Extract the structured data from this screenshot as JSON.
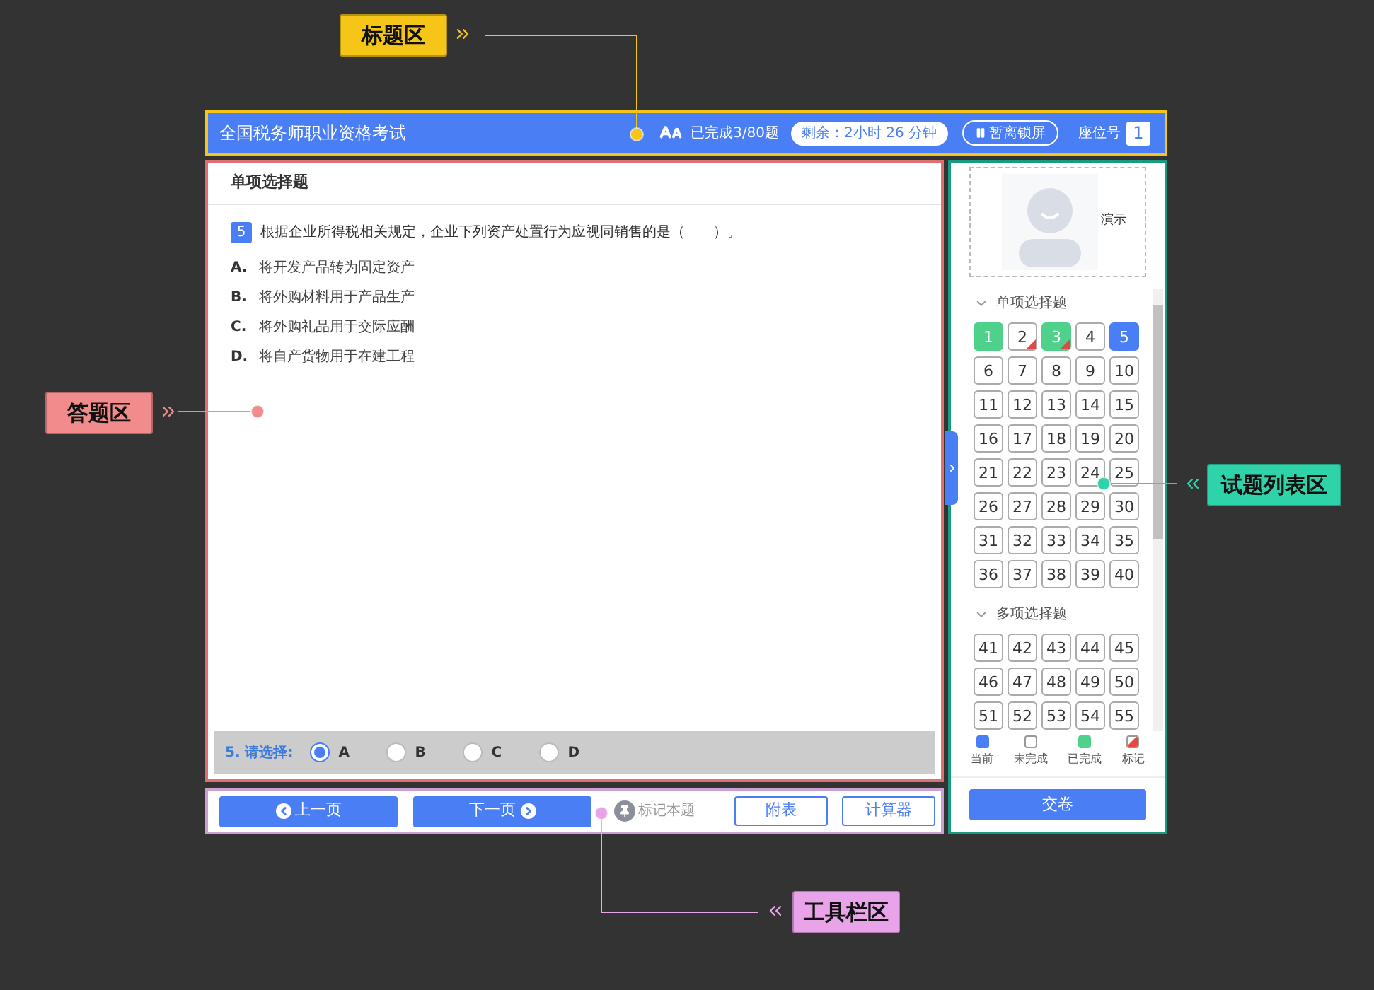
{
  "annotations": [
    {
      "label": "标题区",
      "color": "#f5c518"
    },
    {
      "label": "答题区",
      "color": "#f28b8b"
    },
    {
      "label": "试题列表区",
      "color": "#2fd3a9"
    },
    {
      "label": "工具栏区",
      "color": "#e9a3e9"
    }
  ],
  "header": {
    "title": "全国税务师职业资格考试",
    "progress": "已完成3/80题",
    "timer": "剩余：2小时 26 分钟",
    "lock_button": "暂离锁屏",
    "seat_label": "座位号",
    "seat_number": "1"
  },
  "question": {
    "section": "单项选择题",
    "number": "5",
    "text": "根据企业所得税相关规定，企业下列资产处置行为应视同销售的是（　　）。",
    "options": [
      {
        "letter": "A.",
        "text": "将开发产品转为固定资产"
      },
      {
        "letter": "B.",
        "text": "将外购材料用于产品生产"
      },
      {
        "letter": "C.",
        "text": "将外购礼品用于交际应酬"
      },
      {
        "letter": "D.",
        "text": "将自产货物用于在建工程"
      }
    ]
  },
  "answer_bar": {
    "prompt": "5. 请选择:",
    "choices": [
      {
        "label": "A",
        "selected": true
      },
      {
        "label": "B",
        "selected": false
      },
      {
        "label": "C",
        "selected": false
      },
      {
        "label": "D",
        "selected": false
      }
    ]
  },
  "toolbar": {
    "prev": "上一页",
    "next": "下一页",
    "mark": "标记本题",
    "appendix": "附表",
    "calculator": "计算器"
  },
  "sidebar": {
    "avatar_caption": "演示",
    "groups": [
      {
        "title": "单项选择题",
        "expanded": true,
        "items": [
          {
            "number": "1",
            "selected": false,
            "answered": true,
            "marked": false
          },
          {
            "number": "2",
            "selected": false,
            "answered": false,
            "marked": true
          },
          {
            "number": "3",
            "selected": false,
            "answered": true,
            "marked": true
          },
          {
            "number": "4",
            "selected": false,
            "answered": false,
            "marked": false
          },
          {
            "number": "5",
            "selected": true,
            "marked": false
          },
          {
            "number": "6",
            "selected": false,
            "answered": false,
            "marked": false
          },
          {
            "number": "7",
            "selected": false,
            "answered": false,
            "marked": false
          },
          {
            "number": "8",
            "selected": false,
            "answered": false,
            "marked": false
          },
          {
            "number": "9",
            "selected": false,
            "answered": false,
            "marked": false
          },
          {
            "number": "10",
            "selected": false,
            "answered": false,
            "marked": false
          },
          {
            "number": "11",
            "selected": false,
            "answered": false,
            "marked": false
          },
          {
            "number": "12",
            "selected": false,
            "answered": false,
            "marked": false
          },
          {
            "number": "13",
            "selected": false,
            "answered": false,
            "marked": false
          },
          {
            "number": "14",
            "selected": false,
            "answered": false,
            "marked": false
          },
          {
            "number": "15",
            "selected": false,
            "answered": false,
            "marked": false
          },
          {
            "number": "16",
            "selected": false,
            "answered": false,
            "marked": false
          },
          {
            "number": "17",
            "selected": false,
            "answered": false,
            "marked": false
          },
          {
            "number": "18",
            "selected": false,
            "answered": false,
            "marked": false
          },
          {
            "number": "19",
            "selected": false,
            "answered": false,
            "marked": false
          },
          {
            "number": "20",
            "selected": false,
            "answered": false,
            "marked": false
          },
          {
            "number": "21",
            "selected": false,
            "answered": false,
            "marked": false
          },
          {
            "number": "22",
            "selected": false,
            "answered": false,
            "marked": false
          },
          {
            "number": "23",
            "selected": false,
            "answered": false,
            "marked": false
          },
          {
            "number": "24",
            "selected": false,
            "answered": false,
            "marked": false
          },
          {
            "number": "25",
            "selected": false,
            "answered": false,
            "marked": false
          },
          {
            "number": "26",
            "selected": false,
            "answered": false,
            "marked": false
          },
          {
            "number": "27",
            "selected": false,
            "answered": false,
            "marked": false
          },
          {
            "number": "28",
            "selected": false,
            "answered": false,
            "marked": false
          },
          {
            "number": "29",
            "selected": false,
            "answered": false,
            "marked": false
          },
          {
            "number": "30",
            "selected": false,
            "answered": false,
            "marked": false
          },
          {
            "number": "31",
            "selected": false,
            "answered": false,
            "marked": false
          },
          {
            "number": "32",
            "selected": false,
            "answered": false,
            "marked": false
          },
          {
            "number": "33",
            "selected": false,
            "answered": false,
            "marked": false
          },
          {
            "number": "34",
            "selected": false,
            "answered": false,
            "marked": false
          },
          {
            "number": "35",
            "selected": false,
            "answered": false,
            "marked": false
          },
          {
            "number": "36",
            "selected": false,
            "answered": false,
            "marked": false
          },
          {
            "number": "37",
            "selected": false,
            "answered": false,
            "marked": false
          },
          {
            "number": "38",
            "selected": false,
            "answered": false,
            "marked": false
          },
          {
            "number": "39",
            "selected": false,
            "answered": false,
            "marked": false
          },
          {
            "number": "40",
            "selected": false,
            "answered": false,
            "marked": false
          }
        ]
      },
      {
        "title": "多项选择题",
        "expanded": true,
        "items": [
          {
            "number": "41",
            "selected": false,
            "answered": false,
            "marked": false
          },
          {
            "number": "42",
            "selected": false,
            "answered": false,
            "marked": false
          },
          {
            "number": "43",
            "selected": false,
            "answered": false,
            "marked": false
          },
          {
            "number": "44",
            "selected": false,
            "answered": false,
            "marked": false
          },
          {
            "number": "45",
            "selected": false,
            "answered": false,
            "marked": false
          },
          {
            "number": "46",
            "selected": false,
            "answered": false,
            "marked": false
          },
          {
            "number": "47",
            "selected": false,
            "answered": false,
            "marked": false
          },
          {
            "number": "48",
            "selected": false,
            "answered": false,
            "marked": false
          },
          {
            "number": "49",
            "selected": false,
            "answered": false,
            "marked": false
          },
          {
            "number": "50",
            "selected": false,
            "answered": false,
            "marked": false
          },
          {
            "number": "51",
            "selected": false,
            "answered": false,
            "marked": false
          },
          {
            "number": "52",
            "selected": false,
            "answered": false,
            "marked": false
          },
          {
            "number": "53",
            "selected": false,
            "answered": false,
            "marked": false
          },
          {
            "number": "54",
            "selected": false,
            "answered": false,
            "marked": false
          },
          {
            "number": "55",
            "selected": false,
            "answered": false,
            "marked": false
          }
        ]
      }
    ],
    "legend": [
      {
        "label": "当前",
        "kind": "current"
      },
      {
        "label": "未完成",
        "kind": "undone"
      },
      {
        "label": "已完成",
        "kind": "done"
      },
      {
        "label": "标记",
        "kind": "marked"
      }
    ],
    "submit": "交卷"
  }
}
